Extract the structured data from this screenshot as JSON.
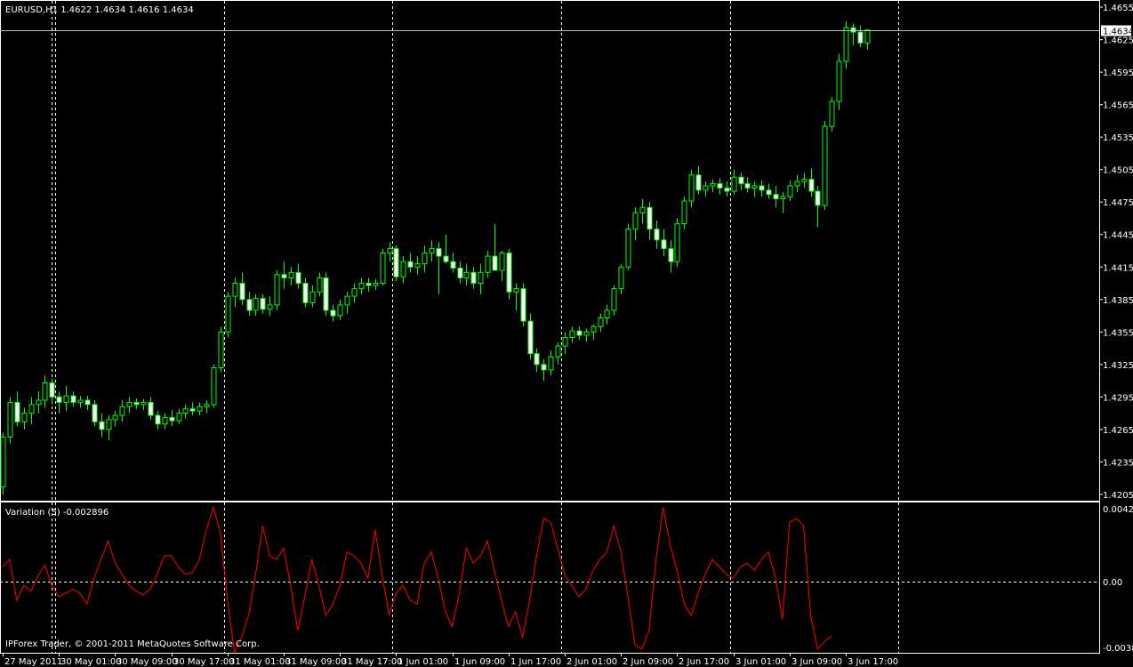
{
  "header": {
    "symbol_info": "EURUSD,H1  1.4622 1.4634 1.4616 1.4634"
  },
  "footer": {
    "copyright": "IPForex Trader, © 2001-2011 MetaQuotes Software Corp."
  },
  "colors": {
    "background": "#000000",
    "frame": "#ffffff",
    "grid": "#ffffff",
    "candle_outline": "#00ff00",
    "candle_bull_body": "#000000",
    "candle_bear_body": "#ffffff",
    "indicator_line": "#ff0000",
    "price_line": "#c0c0c0",
    "axis_text": "#ffffff"
  },
  "chart_data": [
    {
      "type": "candlestick",
      "title": "EURUSD,H1",
      "current_price_label": "1.4634",
      "ylim": [
        1.42,
        1.466
      ],
      "y_ticks": [
        "1.4655",
        "1.4625",
        "1.4595",
        "1.4565",
        "1.4535",
        "1.4505",
        "1.4475",
        "1.4445",
        "1.4415",
        "1.4385",
        "1.4355",
        "1.4325",
        "1.4295",
        "1.4265",
        "1.4235",
        "1.4205"
      ],
      "x_ticks": [
        "27 May 2011",
        "30 May 01:00",
        "30 May 09:00",
        "30 May 17:00",
        "31 May 01:00",
        "31 May 09:00",
        "31 May 17:00",
        "1 Jun 01:00",
        "1 Jun 09:00",
        "1 Jun 17:00",
        "2 Jun 01:00",
        "2 Jun 09:00",
        "2 Jun 17:00",
        "3 Jun 01:00",
        "3 Jun 09:00",
        "3 Jun 17:00"
      ],
      "x_tick_candle_index": [
        0,
        8,
        16,
        24,
        32,
        40,
        48,
        56,
        64,
        72,
        80,
        88,
        96,
        104,
        112,
        120
      ],
      "period_separator_candle_index": [
        7,
        31,
        55,
        79,
        103,
        127
      ],
      "grid": true,
      "candles_ohlc": [
        [
          1.4212,
          1.4262,
          1.4205,
          1.4258
        ],
        [
          1.4258,
          1.4295,
          1.4252,
          1.429
        ],
        [
          1.429,
          1.43,
          1.4268,
          1.4272
        ],
        [
          1.4272,
          1.4285,
          1.4265,
          1.428
        ],
        [
          1.428,
          1.4295,
          1.427,
          1.4288
        ],
        [
          1.4288,
          1.43,
          1.428,
          1.4292
        ],
        [
          1.4292,
          1.4315,
          1.4285,
          1.4308
        ],
        [
          1.4308,
          1.4312,
          1.4288,
          1.4295
        ],
        [
          1.4295,
          1.43,
          1.428,
          1.429
        ],
        [
          1.429,
          1.4305,
          1.4282,
          1.4296
        ],
        [
          1.4296,
          1.43,
          1.4286,
          1.429
        ],
        [
          1.429,
          1.4296,
          1.4285,
          1.4292
        ],
        [
          1.4292,
          1.4296,
          1.4283,
          1.4288
        ],
        [
          1.4288,
          1.4292,
          1.4268,
          1.4272
        ],
        [
          1.4272,
          1.428,
          1.4258,
          1.4265
        ],
        [
          1.4265,
          1.4278,
          1.4255,
          1.4274
        ],
        [
          1.4274,
          1.4282,
          1.4268,
          1.4278
        ],
        [
          1.4278,
          1.4292,
          1.4272,
          1.4286
        ],
        [
          1.4286,
          1.4295,
          1.428,
          1.429
        ],
        [
          1.429,
          1.4294,
          1.4284,
          1.4288
        ],
        [
          1.4288,
          1.4293,
          1.4283,
          1.429
        ],
        [
          1.429,
          1.4295,
          1.4274,
          1.4278
        ],
        [
          1.4278,
          1.4282,
          1.4265,
          1.427
        ],
        [
          1.427,
          1.428,
          1.4265,
          1.4276
        ],
        [
          1.4276,
          1.4283,
          1.4268,
          1.4273
        ],
        [
          1.4273,
          1.4284,
          1.427,
          1.428
        ],
        [
          1.428,
          1.4288,
          1.4275,
          1.4284
        ],
        [
          1.4284,
          1.429,
          1.4278,
          1.4282
        ],
        [
          1.4282,
          1.429,
          1.4278,
          1.4286
        ],
        [
          1.4286,
          1.4292,
          1.428,
          1.4288
        ],
        [
          1.4288,
          1.4325,
          1.4285,
          1.4322
        ],
        [
          1.4322,
          1.436,
          1.4318,
          1.4355
        ],
        [
          1.4355,
          1.4392,
          1.435,
          1.4388
        ],
        [
          1.4388,
          1.4405,
          1.4378,
          1.44
        ],
        [
          1.44,
          1.441,
          1.438,
          1.4385
        ],
        [
          1.4385,
          1.4392,
          1.437,
          1.4375
        ],
        [
          1.4375,
          1.439,
          1.437,
          1.4386
        ],
        [
          1.4386,
          1.439,
          1.4372,
          1.4376
        ],
        [
          1.4376,
          1.4388,
          1.437,
          1.438
        ],
        [
          1.438,
          1.4412,
          1.4375,
          1.4408
        ],
        [
          1.4408,
          1.442,
          1.4395,
          1.4405
        ],
        [
          1.4405,
          1.4415,
          1.4398,
          1.441
        ],
        [
          1.441,
          1.4418,
          1.4395,
          1.44
        ],
        [
          1.44,
          1.4405,
          1.4378,
          1.4382
        ],
        [
          1.4382,
          1.4398,
          1.4378,
          1.4392
        ],
        [
          1.4392,
          1.441,
          1.4388,
          1.4405
        ],
        [
          1.4405,
          1.441,
          1.437,
          1.4375
        ],
        [
          1.4375,
          1.438,
          1.4365,
          1.437
        ],
        [
          1.437,
          1.4385,
          1.4366,
          1.438
        ],
        [
          1.438,
          1.4392,
          1.4372,
          1.4388
        ],
        [
          1.4388,
          1.44,
          1.4382,
          1.4395
        ],
        [
          1.4395,
          1.4405,
          1.439,
          1.44
        ],
        [
          1.44,
          1.4405,
          1.4392,
          1.4398
        ],
        [
          1.4398,
          1.4404,
          1.4394,
          1.44
        ],
        [
          1.44,
          1.4432,
          1.4398,
          1.4428
        ],
        [
          1.4428,
          1.4438,
          1.442,
          1.4432
        ],
        [
          1.4432,
          1.4435,
          1.4402,
          1.4406
        ],
        [
          1.4406,
          1.4425,
          1.44,
          1.442
        ],
        [
          1.442,
          1.4428,
          1.441,
          1.4415
        ],
        [
          1.4415,
          1.4425,
          1.4408,
          1.4418
        ],
        [
          1.4418,
          1.4435,
          1.441,
          1.4428
        ],
        [
          1.4428,
          1.444,
          1.442,
          1.4432
        ],
        [
          1.4432,
          1.4438,
          1.439,
          1.4425
        ],
        [
          1.4425,
          1.4445,
          1.4418,
          1.442
        ],
        [
          1.442,
          1.4428,
          1.441,
          1.4414
        ],
        [
          1.4414,
          1.442,
          1.44,
          1.4405
        ],
        [
          1.4405,
          1.4418,
          1.4398,
          1.441
        ],
        [
          1.441,
          1.4415,
          1.4395,
          1.44
        ],
        [
          1.44,
          1.4418,
          1.439,
          1.441
        ],
        [
          1.441,
          1.443,
          1.4405,
          1.4425
        ],
        [
          1.4425,
          1.4455,
          1.4418,
          1.4412
        ],
        [
          1.4412,
          1.443,
          1.4402,
          1.4428
        ],
        [
          1.4428,
          1.4432,
          1.4385,
          1.4392
        ],
        [
          1.4392,
          1.44,
          1.4375,
          1.4395
        ],
        [
          1.4395,
          1.44,
          1.436,
          1.4365
        ],
        [
          1.4365,
          1.4372,
          1.433,
          1.4335
        ],
        [
          1.4335,
          1.434,
          1.4318,
          1.4325
        ],
        [
          1.4325,
          1.433,
          1.431,
          1.432
        ],
        [
          1.432,
          1.4338,
          1.4315,
          1.4332
        ],
        [
          1.4332,
          1.4345,
          1.4325,
          1.4342
        ],
        [
          1.4342,
          1.4355,
          1.4335,
          1.435
        ],
        [
          1.435,
          1.436,
          1.4345,
          1.4356
        ],
        [
          1.4356,
          1.436,
          1.4348,
          1.4352
        ],
        [
          1.4352,
          1.4358,
          1.4346,
          1.4355
        ],
        [
          1.4355,
          1.4362,
          1.4348,
          1.436
        ],
        [
          1.436,
          1.4372,
          1.4355,
          1.4368
        ],
        [
          1.4368,
          1.438,
          1.4362,
          1.4375
        ],
        [
          1.4375,
          1.4398,
          1.437,
          1.4395
        ],
        [
          1.4395,
          1.4418,
          1.439,
          1.4415
        ],
        [
          1.4415,
          1.4455,
          1.4412,
          1.445
        ],
        [
          1.445,
          1.447,
          1.444,
          1.4465
        ],
        [
          1.4465,
          1.4478,
          1.4455,
          1.447
        ],
        [
          1.447,
          1.4475,
          1.444,
          1.445
        ],
        [
          1.445,
          1.4458,
          1.4432,
          1.444
        ],
        [
          1.444,
          1.445,
          1.4425,
          1.4432
        ],
        [
          1.4432,
          1.444,
          1.441,
          1.442
        ],
        [
          1.442,
          1.446,
          1.4415,
          1.4455
        ],
        [
          1.4455,
          1.448,
          1.445,
          1.4476
        ],
        [
          1.4476,
          1.4505,
          1.447,
          1.45
        ],
        [
          1.45,
          1.4508,
          1.4482,
          1.4486
        ],
        [
          1.4486,
          1.4494,
          1.448,
          1.449
        ],
        [
          1.449,
          1.4496,
          1.4484,
          1.4492
        ],
        [
          1.4492,
          1.4497,
          1.4482,
          1.4488
        ],
        [
          1.4488,
          1.4494,
          1.448,
          1.4485
        ],
        [
          1.4485,
          1.4505,
          1.4482,
          1.4498
        ],
        [
          1.4498,
          1.4502,
          1.4486,
          1.4492
        ],
        [
          1.4492,
          1.4498,
          1.4484,
          1.4488
        ],
        [
          1.4488,
          1.4494,
          1.448,
          1.449
        ],
        [
          1.449,
          1.4495,
          1.448,
          1.4486
        ],
        [
          1.4486,
          1.4492,
          1.4478,
          1.4482
        ],
        [
          1.4482,
          1.449,
          1.447,
          1.4478
        ],
        [
          1.4478,
          1.4484,
          1.4465,
          1.448
        ],
        [
          1.448,
          1.4495,
          1.4476,
          1.449
        ],
        [
          1.449,
          1.45,
          1.4484,
          1.4494
        ],
        [
          1.4494,
          1.4502,
          1.4488,
          1.4496
        ],
        [
          1.4496,
          1.4506,
          1.448,
          1.4485
        ],
        [
          1.4485,
          1.449,
          1.4452,
          1.4472
        ],
        [
          1.4472,
          1.455,
          1.4468,
          1.4545
        ],
        [
          1.4545,
          1.4572,
          1.454,
          1.4568
        ],
        [
          1.4568,
          1.4612,
          1.456,
          1.4605
        ],
        [
          1.4605,
          1.4642,
          1.4598,
          1.4636
        ],
        [
          1.4636,
          1.464,
          1.462,
          1.4632
        ],
        [
          1.4632,
          1.4638,
          1.4618,
          1.4622
        ],
        [
          1.4622,
          1.4634,
          1.4616,
          1.4634
        ]
      ]
    },
    {
      "type": "line",
      "title": "Variation (5) -0.002896",
      "ylim": [
        -0.00381,
        0.00421
      ],
      "y_ticks": [
        "0.00421",
        "0.00",
        "-0.00381"
      ],
      "zero_line": true,
      "series": [
        {
          "name": "Variation (5)",
          "values": [
            0.0008,
            0.0012,
            -0.001,
            -0.0002,
            -0.0005,
            0.0003,
            0.0009,
            -0.0002,
            -0.0008,
            -0.0006,
            -0.0004,
            -0.0006,
            -0.0012,
            0.0002,
            0.0012,
            0.0022,
            0.001,
            0.0004,
            -0.0002,
            -0.0005,
            -0.0007,
            -0.0004,
            0.0004,
            0.0014,
            0.0014,
            0.0008,
            0.0004,
            0.0005,
            0.0012,
            0.0028,
            0.004,
            0.0026,
            -0.001,
            -0.0038,
            -0.003,
            -0.0018,
            0.0004,
            0.003,
            0.0014,
            0.0012,
            0.0018,
            -0.0002,
            -0.0026,
            -0.0008,
            0.0012,
            -0.0002,
            -0.0018,
            -0.0012,
            -0.0002,
            0.0016,
            0.0014,
            0.001,
            0.0002,
            0.0028,
            0.0004,
            -0.0018,
            -0.0006,
            -0.0002,
            -0.001,
            -0.0012,
            0.001,
            0.0016,
            0.0002,
            -0.0016,
            -0.0024,
            -0.0006,
            0.0018,
            0.001,
            0.0014,
            0.0022,
            0.0006,
            -0.001,
            -0.0024,
            -0.0016,
            -0.003,
            -0.001,
            0.0014,
            0.0034,
            0.0032,
            0.0018,
            0.0004,
            -0.0002,
            -0.0008,
            -0.0004,
            0.0006,
            0.0012,
            0.0016,
            0.003,
            0.0016,
            -0.0008,
            -0.0034,
            -0.0036,
            -0.0026,
            0.0012,
            0.004,
            0.002,
            0.0006,
            -0.0012,
            -0.0018,
            -0.0006,
            0.0004,
            0.0012,
            0.0008,
            0.0004,
            0.0002,
            0.0008,
            0.001,
            0.0006,
            0.0012,
            0.0016,
            0.0002,
            -0.002,
            0.0032,
            0.0034,
            0.003,
            -0.0018,
            -0.0036,
            -0.0032,
            -0.0029
          ]
        }
      ]
    }
  ]
}
